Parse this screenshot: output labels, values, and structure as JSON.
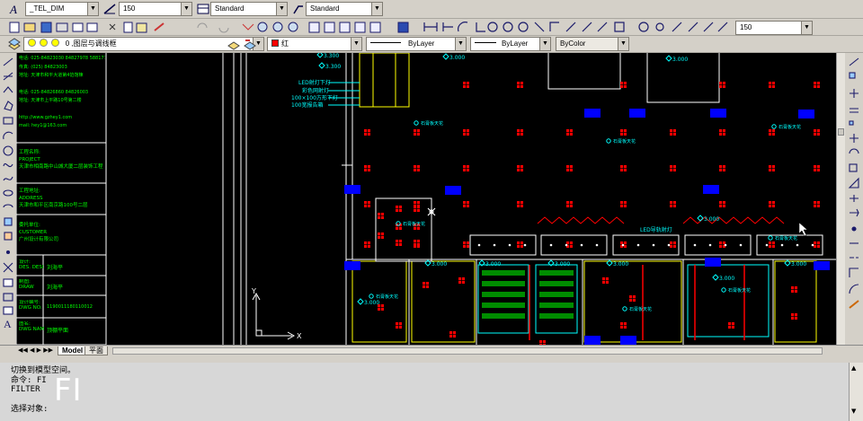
{
  "toolbar": {
    "dimstyle": "_TEL_DIM",
    "scale1": "150",
    "textstyle": "Standard",
    "tablestyle": "Standard",
    "scale2": "150",
    "layer_name": "0 ,图层与调线框",
    "color": "红",
    "linetype": "ByLayer",
    "lineweight": "ByLayer",
    "plotstyle": "ByColor"
  },
  "title_block": {
    "lines": [
      "电话: 025-84823030  84827978  58817712",
      "传真: (025) 84823003",
      "地址: 天津市和平大道第4馅馆楝",
      "电话: 025-84826860  84826003",
      "地址: 天津市上平路10号第二楼",
      "http://www.gzhey1.com",
      "mail: hey1@163.com"
    ],
    "project_label": "工程名称:",
    "project_en": "PROJECT",
    "project_name": "天津市相南路中山城大厦二层装饰工程",
    "location_label": "工程地址:",
    "location_en": "ADDRESS",
    "location_value": "天津市和平区南京路100号二层",
    "client_label": "委托单位:",
    "client_en": "CUSTOMER",
    "client_value": "广州设计有限公司",
    "designer_label": "设计:",
    "designer_en": "DES. DESIGNER",
    "designer_value": "刘海平",
    "drawn_label": "制图:",
    "drawn_en": "DRAW",
    "drawn_value": "刘海平",
    "drawing_no_label": "设计编号:",
    "drawing_no_en": "DWG NO.",
    "drawing_no_value": "1190011180110012",
    "sheet_label": "图名:",
    "sheet_en": "DWG NAME",
    "sheet_value": "顶棚平面"
  },
  "drawing": {
    "legend": [
      "LED射灯下灯",
      "彩色网射灯",
      "100×100方形下灯",
      "100宽报告箱"
    ],
    "elevations": [
      "3.300",
      "3.300",
      "3.000",
      "3.000",
      "3.000",
      "3.000",
      "3.000",
      "3.000",
      "3.000",
      "3.000",
      "3.000",
      "3.000"
    ],
    "tags": [
      "石膏板天花",
      "石膏板天花",
      "石膏板天花",
      "石膏板天花",
      "石膏板天花",
      "石膏板天花",
      "石膏板天花",
      "石膏板天花"
    ],
    "light_label": "LED导轨射灯",
    "axis_y": "Y",
    "axis_x": "X"
  },
  "tabs": [
    "Model",
    "平面"
  ],
  "command": {
    "lines": [
      "切换到模型空间。",
      "命令: FI",
      "FILTER",
      "选择对象:"
    ],
    "overlay": "FI"
  },
  "colors": {
    "canvas": "#000000",
    "cad_green": "#00ff00",
    "cad_red": "#ff0000",
    "cad_blue": "#0000ff",
    "cad_yellow": "#ffff00",
    "cad_cyan": "#00ffff",
    "cad_white": "#ffffff",
    "cad_magenta": "#ff00ff"
  }
}
